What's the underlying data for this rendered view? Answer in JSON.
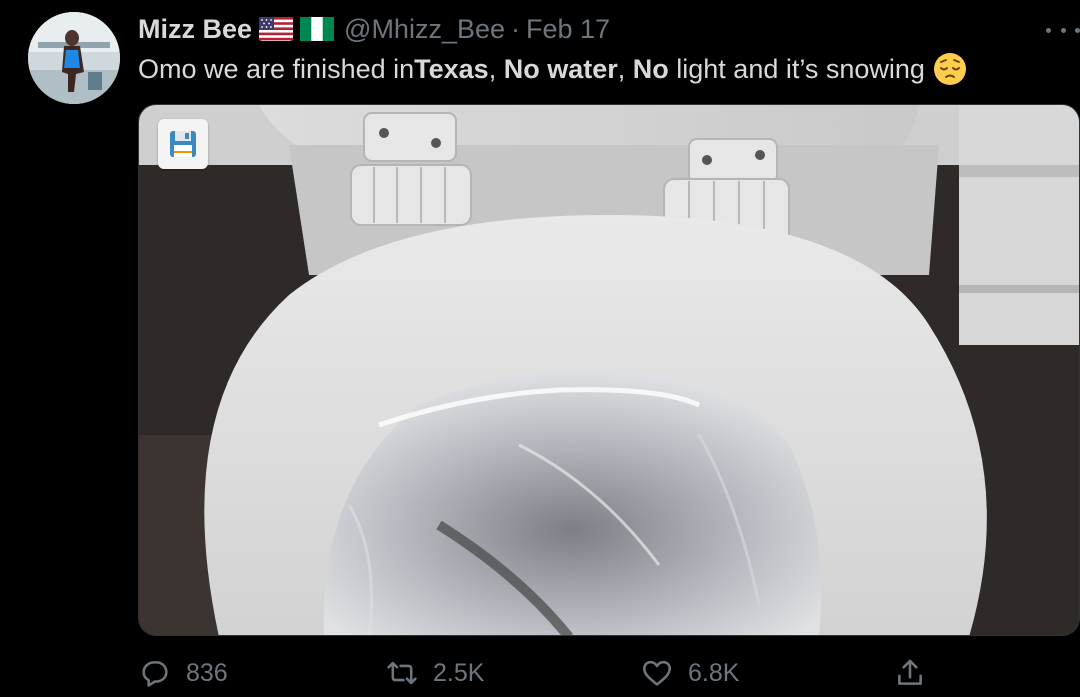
{
  "tweet": {
    "display_name": "Mizz Bee",
    "flags": [
      "us-flag-icon",
      "nigeria-flag-icon"
    ],
    "handle": "@Mhizz_Bee",
    "separator": "·",
    "date": "Feb 17",
    "text_parts": [
      {
        "text": "Omo we are finished in ",
        "bold": false
      },
      {
        "text": "Texas",
        "bold": true
      },
      {
        "text": ", ",
        "bold": false
      },
      {
        "text": "No water",
        "bold": true
      },
      {
        "text": ", ",
        "bold": false
      },
      {
        "text": "No",
        "bold": true
      },
      {
        "text": " light and it’s snowing",
        "bold": false
      }
    ],
    "emoji": "pensive-face-icon"
  },
  "media": {
    "description_icon": "floppy-disk-icon"
  },
  "actions": {
    "reply_count": "836",
    "retweet_count": "2.5K",
    "like_count": "6.8K"
  },
  "colors": {
    "background": "#000000",
    "primary_text": "#d9d9d9",
    "secondary_text": "#6e767d",
    "border": "#2f3336"
  }
}
